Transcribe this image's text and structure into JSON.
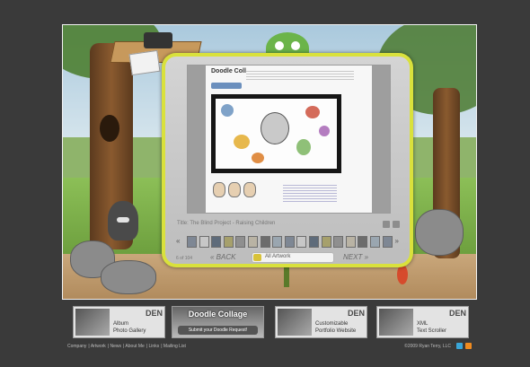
{
  "viewer": {
    "site_logo": "Doodle Collage",
    "title": "Title: The Blind Project - Raising Children",
    "count": "6 of 104",
    "back_label": "BACK",
    "next_label": "NEXT",
    "filter_label": "All Artwork",
    "thumb_count": 17
  },
  "tiles": [
    {
      "den": "DEN",
      "line1": "Album",
      "line2": "Photo Gallery"
    },
    {
      "banner_title": "Doodle Collage",
      "banner_sub": "Submit your Doodle Request!"
    },
    {
      "den": "DEN",
      "line1": "Customizable",
      "line2": "Portfolio Website"
    },
    {
      "den": "DEN",
      "line1": "XML",
      "line2": "Text Scroller"
    }
  ],
  "footer": {
    "links": [
      "Company",
      "Artwork",
      "News",
      "About Me",
      "Links",
      "Mailing List"
    ],
    "copyright": "©2009 Ryan Terry, LLC"
  },
  "colors": {
    "frame": "#d9e13c",
    "background": "#3a3a3a",
    "twitter": "#3aa6d8",
    "rss": "#f08b1f"
  },
  "icons": [
    "twitter-icon",
    "rss-icon",
    "play-icon",
    "zoom-icon",
    "fullscreen-icon"
  ]
}
